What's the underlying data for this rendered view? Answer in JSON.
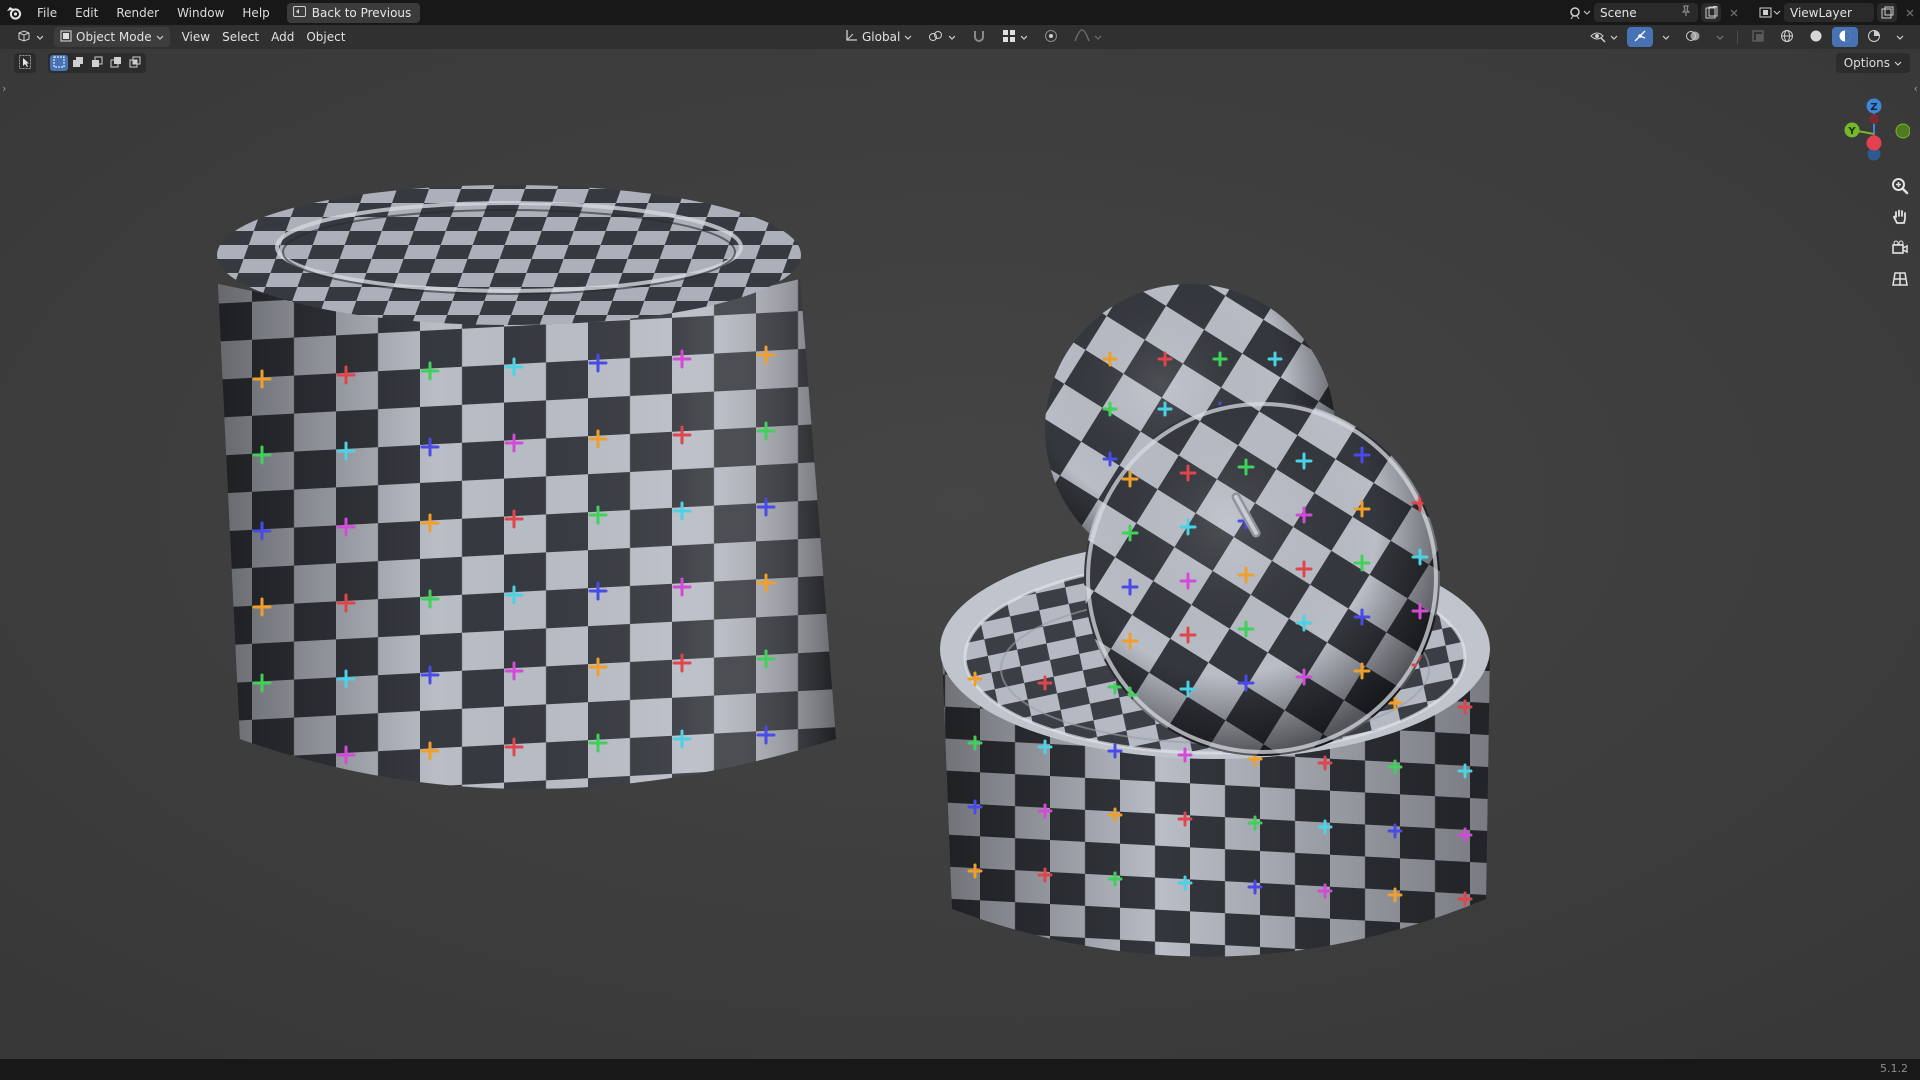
{
  "topbar": {
    "menu": [
      "File",
      "Edit",
      "Render",
      "Window",
      "Help"
    ],
    "back_label": "Back to Previous",
    "scene_name": "Scene",
    "view_layer_name": "ViewLayer"
  },
  "header": {
    "mode_label": "Object Mode",
    "menu": [
      "View",
      "Select",
      "Add",
      "Object"
    ],
    "transform_orientation": "Global"
  },
  "viewport": {
    "options_label": "Options",
    "gizmo": {
      "z_label": "Z",
      "y_label": "Y",
      "colors": {
        "x": "#e2414f",
        "y": "#76b82a",
        "z": "#3f86d6"
      }
    },
    "nav_icons": [
      "zoom-icon",
      "pan-hand-icon",
      "camera-icon",
      "perspective-grid-icon"
    ],
    "objects": [
      "cylinder",
      "sphere",
      "ring-dish"
    ],
    "texture_colors": [
      "#f0a02a",
      "#e0454c",
      "#3fd15a",
      "#4ad2e6",
      "#4a4ae8",
      "#d34ad8"
    ]
  },
  "status": {
    "version": "5.1.2"
  }
}
